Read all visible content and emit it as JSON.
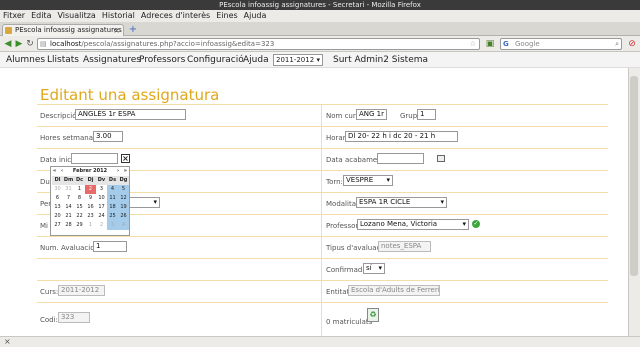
{
  "window": {
    "title": "PEscola infoassig assignatures - Secretari - Mozilla Firefox"
  },
  "browser_menu": [
    "Fitxer",
    "Edita",
    "Visualitza",
    "Historial",
    "Adreces d'interès",
    "Eines",
    "Ajuda"
  ],
  "tab": {
    "title": "PEscola infoassig assignatures ...",
    "close": "×",
    "new": "+"
  },
  "url": {
    "host": "localhost",
    "path": "/pescola/assignatures.php?accio=infoassig&edita=323"
  },
  "search": {
    "placeholder": "Google"
  },
  "app_nav": {
    "items": [
      "Alumnes",
      "Llistats",
      "Assignatures",
      "Professors",
      "Configuració",
      "Ajuda"
    ],
    "year": "2011-2012",
    "logout": "Surt Admin2 Sistema"
  },
  "page": {
    "title": "Editant una assignatura"
  },
  "form": {
    "descripcio_label": "Descripció:",
    "descripcio_value": "ANGLÈS 1r ESPA",
    "nom_curt_label": "Nom curt:",
    "nom_curt_value": "ANG 1r",
    "grup_label": "Grup:",
    "grup_value": "1",
    "hores_label": "Hores setmanals:",
    "hores_value": "3.00",
    "horari_label": "Horari:",
    "horari_value": "Dl 20- 22 h i dc 20 - 21 h",
    "data_inici_label": "Data inici:",
    "data_inici_value": "",
    "data_acabament_label": "Data acabament:",
    "data_acabament_value": "",
    "dur_label": "Dur",
    "torn_label": "Torn:",
    "torn_value": "VESPRE",
    "per_label": "Per",
    "modalitat_label": "Modalitat:",
    "modalitat_value": "ESPA 1R CICLE",
    "mi_label": "Mi",
    "professor_label": "Professor:",
    "professor_value": "Lozano Mena, Victoria",
    "num_avaluacions_label": "Num. Avaluacions:",
    "num_avaluacions_value": "1",
    "tipus_avaluacio_label": "Tipus d'avaluació:",
    "tipus_avaluacio_value": "notes_ESPA",
    "confirmada_label": "Confirmada:",
    "confirmada_value": "sí",
    "curs_label": "Curs:",
    "curs_value": "2011-2012",
    "entitat_label": "Entitat:",
    "entitat_value": "Escola d'Adults de Ferreries",
    "codi_label": "Codi:",
    "codi_value": "323",
    "matriculats": "0 matriculats"
  },
  "calendar": {
    "nav": [
      "«",
      "‹",
      "›",
      "»"
    ],
    "month": "Febrer 2012",
    "close": "×",
    "weekday_headers": [
      "Dl",
      "Dm",
      "Dc",
      "Dj",
      "Dv",
      "Ds",
      "Dg"
    ],
    "weeks": [
      [
        "30",
        "31",
        "1",
        "2",
        "3",
        "4",
        "5"
      ],
      [
        "6",
        "7",
        "8",
        "9",
        "10",
        "11",
        "12"
      ],
      [
        "13",
        "14",
        "15",
        "16",
        "17",
        "18",
        "19"
      ],
      [
        "20",
        "21",
        "22",
        "23",
        "24",
        "25",
        "26"
      ],
      [
        "27",
        "28",
        "29",
        "1",
        "2",
        "3",
        "4"
      ]
    ],
    "today": "2"
  },
  "colors": {
    "accent": "#e0a81a",
    "weekend": "#a4cbea",
    "today": "#e86b6b"
  },
  "status": "×"
}
